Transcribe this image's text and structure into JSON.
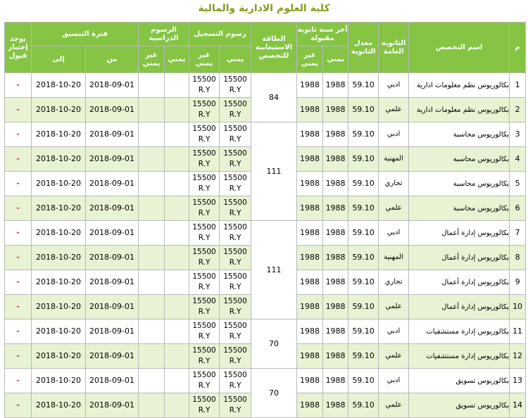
{
  "title": "كلية العلوم الادارية والمالية",
  "headers": {
    "num": "م",
    "major": "اسم التخصص",
    "track": "الثانوية العامة",
    "avg": "معدل الثانوية",
    "last_year": "آخر سنة ثانوية مقبولة",
    "capacity": "الطاقة الاستيعابية للتخصص",
    "reg_fees": "رسوم التسجيل",
    "study_fees": "الرسوم الدراسية",
    "period": "فترة التنسيق",
    "exam": "يوجد إختبار قبول",
    "yemeni": "يمني",
    "non_yemeni": "غير يمني",
    "from": "من",
    "to": "إلى"
  },
  "capacity_groups": [
    "84",
    "111",
    "111",
    "70",
    "70"
  ],
  "rows": [
    {
      "num": "1",
      "major": "بكالوريوس نظم معلومات ادارية",
      "track": "ادبي",
      "avg": "59.10",
      "year_y": "1988",
      "year_ny": "1988",
      "reg_y": "15500 R.Y",
      "reg_ny": "15500 R.Y",
      "study_y": "",
      "study_ny": "",
      "from": "2018-09-01",
      "to": "2018-10-20",
      "exam": "-"
    },
    {
      "num": "2",
      "major": "بكالوريوس نظم معلومات ادارية",
      "track": "علمي",
      "avg": "59.10",
      "year_y": "1988",
      "year_ny": "1988",
      "reg_y": "15500 R.Y",
      "reg_ny": "15500 R.Y",
      "study_y": "",
      "study_ny": "",
      "from": "2018-09-01",
      "to": "2018-10-20",
      "exam": "-"
    },
    {
      "num": "3",
      "major": "بكالوريوس محاسبة",
      "track": "ادبي",
      "avg": "59.10",
      "year_y": "1988",
      "year_ny": "1988",
      "reg_y": "15500 R.Y",
      "reg_ny": "15500 R.Y",
      "study_y": "",
      "study_ny": "",
      "from": "2018-09-01",
      "to": "2018-10-20",
      "exam": "-"
    },
    {
      "num": "4",
      "major": "بكالوريوس محاسبة",
      "track": "المهنية",
      "avg": "59.10",
      "year_y": "1988",
      "year_ny": "1988",
      "reg_y": "15500 R.Y",
      "reg_ny": "15500 R.Y",
      "study_y": "",
      "study_ny": "",
      "from": "2018-09-01",
      "to": "2018-10-20",
      "exam": "-"
    },
    {
      "num": "5",
      "major": "بكالوريوس محاسبة",
      "track": "تجاري",
      "avg": "59.10",
      "year_y": "1988",
      "year_ny": "1988",
      "reg_y": "15500 R.Y",
      "reg_ny": "15500 R.Y",
      "study_y": "",
      "study_ny": "",
      "from": "2018-09-01",
      "to": "2018-10-20",
      "exam": "-"
    },
    {
      "num": "6",
      "major": "بكالوريوس محاسبة",
      "track": "علمي",
      "avg": "59.10",
      "year_y": "1988",
      "year_ny": "1988",
      "reg_y": "15500 R.Y",
      "reg_ny": "15500 R.Y",
      "study_y": "",
      "study_ny": "",
      "from": "2018-09-01",
      "to": "2018-10-20",
      "exam": "-"
    },
    {
      "num": "7",
      "major": "بكالوريوس إدارة أعمال",
      "track": "ادبي",
      "avg": "59.10",
      "year_y": "1988",
      "year_ny": "1988",
      "reg_y": "15500 R.Y",
      "reg_ny": "15500 R.Y",
      "study_y": "",
      "study_ny": "",
      "from": "2018-09-01",
      "to": "2018-10-20",
      "exam": "-"
    },
    {
      "num": "8",
      "major": "بكالوريوس إدارة أعمال",
      "track": "المهنية",
      "avg": "59.10",
      "year_y": "1988",
      "year_ny": "1988",
      "reg_y": "15500 R.Y",
      "reg_ny": "15500 R.Y",
      "study_y": "",
      "study_ny": "",
      "from": "2018-09-01",
      "to": "2018-10-20",
      "exam": "-"
    },
    {
      "num": "9",
      "major": "بكالوريوس إدارة أعمال",
      "track": "تجاري",
      "avg": "59.10",
      "year_y": "1988",
      "year_ny": "1988",
      "reg_y": "15500 R.Y",
      "reg_ny": "15500 R.Y",
      "study_y": "",
      "study_ny": "",
      "from": "2018-09-01",
      "to": "2018-10-20",
      "exam": "-"
    },
    {
      "num": "10",
      "major": "بكالوريوس إدارة أعمال",
      "track": "علمي",
      "avg": "59.10",
      "year_y": "1988",
      "year_ny": "1988",
      "reg_y": "15500 R.Y",
      "reg_ny": "15500 R.Y",
      "study_y": "",
      "study_ny": "",
      "from": "2018-09-01",
      "to": "2018-10-20",
      "exam": "-"
    },
    {
      "num": "11",
      "major": "بكالوريوس إدارة مستشفيات",
      "track": "ادبي",
      "avg": "59.10",
      "year_y": "1988",
      "year_ny": "1988",
      "reg_y": "15500 R.Y",
      "reg_ny": "15500 R.Y",
      "study_y": "",
      "study_ny": "",
      "from": "2018-09-01",
      "to": "2018-10-20",
      "exam": "-"
    },
    {
      "num": "12",
      "major": "بكالوريوس إدارة مستشفيات",
      "track": "علمي",
      "avg": "59.10",
      "year_y": "1988",
      "year_ny": "1988",
      "reg_y": "15500 R.Y",
      "reg_ny": "15500 R.Y",
      "study_y": "",
      "study_ny": "",
      "from": "2018-09-01",
      "to": "2018-10-20",
      "exam": "-"
    },
    {
      "num": "13",
      "major": "بكالوريوس تسويق",
      "track": "ادبي",
      "avg": "59.10",
      "year_y": "1988",
      "year_ny": "1988",
      "reg_y": "15500 R.Y",
      "reg_ny": "15500 R.Y",
      "study_y": "",
      "study_ny": "",
      "from": "2018-09-01",
      "to": "2018-10-20",
      "exam": "-"
    },
    {
      "num": "14",
      "major": "بكالوريوس تسويق",
      "track": "علمي",
      "avg": "59.10",
      "year_y": "1988",
      "year_ny": "1988",
      "reg_y": "15500 R.Y",
      "reg_ny": "15500 R.Y",
      "study_y": "",
      "study_ny": "",
      "from": "2018-09-01",
      "to": "2018-10-20",
      "exam": "-"
    }
  ]
}
